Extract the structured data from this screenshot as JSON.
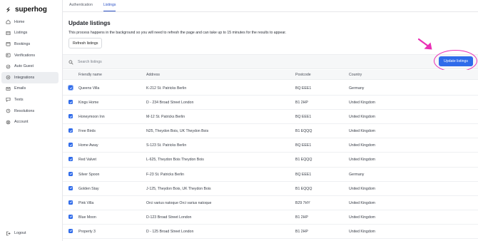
{
  "app": {
    "brand": "superhog",
    "accent": "#2f6bea",
    "highlight": "#ea2fb5"
  },
  "sidebar": {
    "items": [
      {
        "label": "Home",
        "icon": "home-icon"
      },
      {
        "label": "Listings",
        "icon": "listings-icon"
      },
      {
        "label": "Bookings",
        "icon": "bookings-icon"
      },
      {
        "label": "Verifications",
        "icon": "verifications-icon"
      },
      {
        "label": "Auto Guest",
        "icon": "auto-guest-icon"
      },
      {
        "label": "Integrations",
        "icon": "integrations-icon",
        "active": true
      },
      {
        "label": "Emails",
        "icon": "email-icon"
      },
      {
        "label": "Texts",
        "icon": "texts-icon"
      },
      {
        "label": "Resolutions",
        "icon": "resolutions-icon"
      },
      {
        "label": "Account",
        "icon": "account-icon"
      }
    ],
    "logout": "Logout"
  },
  "tabs": [
    {
      "label": "Authentication",
      "active": false
    },
    {
      "label": "Listings",
      "active": true
    }
  ],
  "main": {
    "title": "Update listings",
    "description": "This process happens in the background so you will need to refresh the page and can take up to 15 minutes for the results to appear.",
    "refresh_label": "Refresh listings",
    "search_placeholder": "Search listings",
    "update_label": "Update listings"
  },
  "table": {
    "columns": [
      "Friendly name",
      "Address",
      "Postcode",
      "Country"
    ],
    "rows": [
      {
        "name": "Queens Villa",
        "address": "K-212 St. Patricks Berlin",
        "postcode": "BQ EEE1",
        "country": "Germany",
        "checked": true
      },
      {
        "name": "Kings Home",
        "address": "D - 234 Broad Street London",
        "postcode": "B1 2HP",
        "country": "United Kingdom",
        "checked": true
      },
      {
        "name": "Honeymoon Inn",
        "address": "M-12 St. Patricks Berlin",
        "postcode": "BQ EEE1",
        "country": "United Kingdom",
        "checked": true
      },
      {
        "name": "Free Birds",
        "address": "N25, Theydon Bois, UK Theydon Bois",
        "postcode": "B1 EQQQ",
        "country": "United Kingdom",
        "checked": true
      },
      {
        "name": "Home Away",
        "address": "S-123 St. Patricks Berlin",
        "postcode": "BQ EEE1",
        "country": "United Kingdom",
        "checked": true
      },
      {
        "name": "Red Valvet",
        "address": "L-625, Theydon Bois Theydon Bois",
        "postcode": "B1 EQQQ",
        "country": "United Kingdom",
        "checked": true
      },
      {
        "name": "Silver Spoon",
        "address": "F-23 St. Patricks Berlin",
        "postcode": "BQ EEE1",
        "country": "Germany",
        "checked": true
      },
      {
        "name": "Golden Stay",
        "address": "J-125, Theydon Bois, UK Theydon Bois",
        "postcode": "B1 EQQQ",
        "country": "United Kingdom",
        "checked": true
      },
      {
        "name": "Pink Villa",
        "address": "Orci varius natoque Orci varius natoque",
        "postcode": "B29 7HY",
        "country": "United Kingdom",
        "checked": true
      },
      {
        "name": "Blue Moon",
        "address": "D-123 Broad Street London",
        "postcode": "B1 2HP",
        "country": "United Kingdom",
        "checked": true
      },
      {
        "name": "Property 3",
        "address": "D - 125 Broad Street London",
        "postcode": "B1 2HP",
        "country": "United Kingdom",
        "checked": true
      }
    ]
  }
}
